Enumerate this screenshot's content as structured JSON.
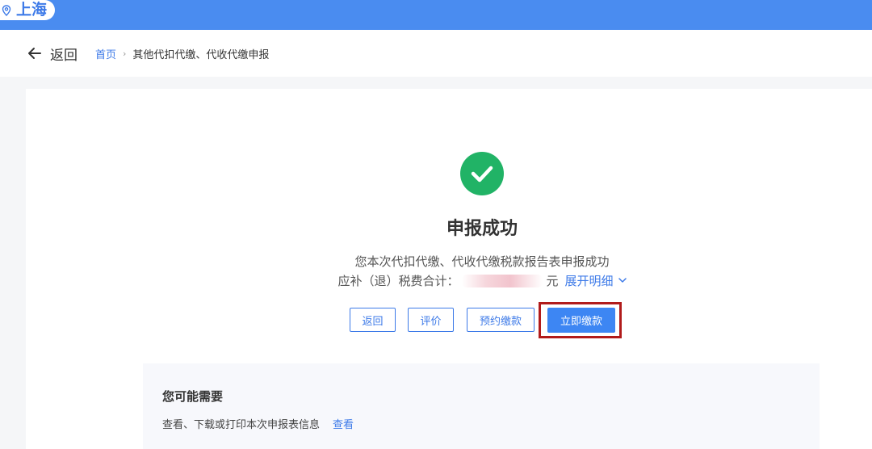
{
  "location": {
    "city": "上海",
    "icon": "location-pin-icon"
  },
  "nav": {
    "back_label": "返回",
    "breadcrumb": {
      "home": "首页",
      "separator": "›",
      "current": "其他代扣代缴、代收代缴申报"
    }
  },
  "result": {
    "status_icon": "check-circle-icon",
    "title": "申报成功",
    "description": "您本次代扣代缴、代收代缴税款报告表申报成功",
    "total_label": "应补（退）税费合计：",
    "total_unit": "元",
    "expand_label": "展开明细"
  },
  "actions": {
    "return_label": "返回",
    "rate_label": "评价",
    "appoint_label": "预约缴款",
    "pay_label": "立即缴款"
  },
  "maybe": {
    "title": "您可能需要",
    "item_text": "查看、下载或打印本次申报表信息",
    "item_link": "查看"
  },
  "colors": {
    "topbar": "#4a8cf0",
    "accent": "#3d7ae8",
    "success": "#21b366",
    "highlight": "#b11b1b"
  }
}
